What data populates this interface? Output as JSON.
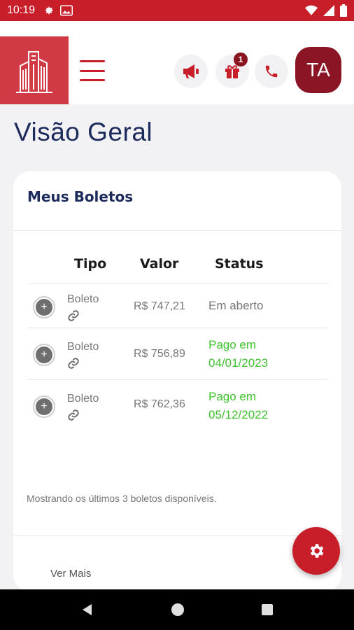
{
  "status_bar": {
    "time": "10:19"
  },
  "header": {
    "avatar_initials": "TA",
    "notification_badge": "1"
  },
  "page": {
    "title": "Visão Geral"
  },
  "card": {
    "title": "Meus Boletos",
    "columns": {
      "tipo": "Tipo",
      "valor": "Valor",
      "status": "Status"
    },
    "rows": [
      {
        "tipo": "Boleto",
        "valor": "R$ 747,21",
        "status_line1": "Em aberto",
        "status_line2": ""
      },
      {
        "tipo": "Boleto",
        "valor": "R$ 756,89",
        "status_line1": "Pago em",
        "status_line2": "04/01/2023"
      },
      {
        "tipo": "Boleto",
        "valor": "R$ 762,36",
        "status_line1": "Pago em",
        "status_line2": "05/12/2022"
      }
    ],
    "footnote": "Mostrando os últimos 3 boletos disponíveis.",
    "ver_mais": "Ver Mais"
  },
  "colors": {
    "brand_red": "#c81e2a",
    "navy": "#1c2a5c",
    "paid_green": "#3fc22e",
    "avatar_bg": "#8b1525"
  },
  "icons": [
    "settings-icon",
    "image-icon",
    "wifi-icon",
    "signal-icon",
    "battery-icon",
    "building-logo",
    "hamburger-icon",
    "megaphone-icon",
    "gift-icon",
    "phone-icon",
    "link-icon",
    "gear-icon",
    "back-icon",
    "home-icon",
    "recents-icon"
  ]
}
